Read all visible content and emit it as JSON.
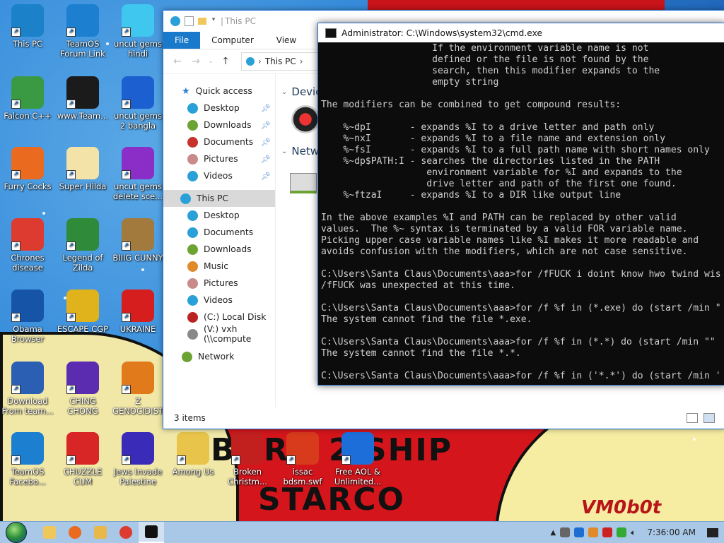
{
  "desktop_icons": [
    {
      "label": "This PC",
      "icon": "this-pc-icon",
      "color": "#1b82c9"
    },
    {
      "label": "TeamOS Forum Link",
      "icon": "gear-icon",
      "color": "#1c7fd0"
    },
    {
      "label": "uncut gems hindi",
      "icon": "diamond-icon",
      "color": "#3fc7ef"
    },
    {
      "label": "Falcon C++",
      "icon": "recycle-icon",
      "color": "#3a9a44"
    },
    {
      "label": "www.Team...",
      "icon": "book-icon",
      "color": "#1b1b1b"
    },
    {
      "label": "uncut gems 2 bangla",
      "icon": "number-two-icon",
      "color": "#1b5fd1"
    },
    {
      "label": "Furry Cocks",
      "icon": "firefox-icon",
      "color": "#ea6a1f"
    },
    {
      "label": "Super Hilda",
      "icon": "pixel-dog-icon",
      "color": "#f4e3a8"
    },
    {
      "label": "uncut gems delete sce...",
      "icon": "gem-icon",
      "color": "#8a2ec7"
    },
    {
      "label": "Chrones disease",
      "icon": "chrome-icon",
      "color": "#dd3b2f"
    },
    {
      "label": "Legend of Zilda",
      "icon": "pixel-hero-icon",
      "color": "#2f8a3a"
    },
    {
      "label": "BIIIG CUNNY",
      "icon": "money-bag-icon",
      "color": "#a27a3d"
    },
    {
      "label": "Obama Browser",
      "icon": "obama-logo-icon",
      "color": "#1654a8"
    },
    {
      "label": "ESCAPE CGP",
      "icon": "box-icon",
      "color": "#e0b21c"
    },
    {
      "label": "UKRAINE",
      "icon": "radiation-icon",
      "color": "#d61e1e"
    },
    {
      "label": "Download From team...",
      "icon": "download-icon",
      "color": "#2b5fb4"
    },
    {
      "label": "CHING CHONG",
      "icon": "orb-icon",
      "color": "#5b2bb0"
    },
    {
      "label": "Z GENOCIDIST",
      "icon": "cube-z-icon",
      "color": "#e07a1a"
    },
    {
      "label": "TeamOS Facebo...",
      "icon": "gear-icon",
      "color": "#1c7fd0"
    },
    {
      "label": "CHUZZLE CUM",
      "icon": "chuzzle-icon",
      "color": "#d82525"
    },
    {
      "label": "Jews Invade Palestine",
      "icon": "orb-icon",
      "color": "#3a2bb8"
    },
    {
      "label": "Among Us",
      "icon": "folder-icon",
      "color": "#e8c54a"
    },
    {
      "label": "Broken Christm...",
      "icon": "ornament-icon",
      "color": "#c2201f"
    },
    {
      "label": "issac bdsm.swf",
      "icon": "swf-file-icon",
      "color": "#d83a1c"
    },
    {
      "label": "Free AOL & Unlimited...",
      "icon": "aol-icon",
      "color": "#1e6ed9"
    }
  ],
  "wallpaper": {
    "text_top": "BORN 2 SHIP",
    "text_bottom": "STARCO",
    "signature": "VM0b0t"
  },
  "explorer": {
    "title": "This PC",
    "tabs": [
      "File",
      "Computer",
      "View"
    ],
    "address": "This PC",
    "nav": {
      "quick_access": "Quick access",
      "quick_items": [
        {
          "label": "Desktop",
          "icon": "desktop-icon",
          "color": "#2aa0d8"
        },
        {
          "label": "Downloads",
          "icon": "downloads-icon",
          "color": "#6da332"
        },
        {
          "label": "Documents",
          "icon": "documents-icon",
          "color": "#c8322c"
        },
        {
          "label": "Pictures",
          "icon": "pictures-icon",
          "color": "#c98a8a"
        },
        {
          "label": "Videos",
          "icon": "videos-icon",
          "color": "#2aa0d8"
        }
      ],
      "this_pc": "This PC",
      "pc_items": [
        {
          "label": "Desktop",
          "icon": "desktop-icon",
          "color": "#2aa0d8"
        },
        {
          "label": "Documents",
          "icon": "documents-icon",
          "color": "#2aa0d8"
        },
        {
          "label": "Downloads",
          "icon": "downloads-icon",
          "color": "#6da332"
        },
        {
          "label": "Music",
          "icon": "music-icon",
          "color": "#e08a2a"
        },
        {
          "label": "Pictures",
          "icon": "pictures-icon",
          "color": "#c98a8a"
        },
        {
          "label": "Videos",
          "icon": "videos-icon",
          "color": "#2aa0d8"
        },
        {
          "label": "(C:) Local Disk",
          "icon": "local-disk-icon",
          "color": "#b22"
        },
        {
          "label": "(V:) vxh (\\\\compute",
          "icon": "network-drive-icon",
          "color": "#888"
        }
      ],
      "network": "Network"
    },
    "content_groups": [
      "Devic",
      "Netwo"
    ],
    "status": "3 items"
  },
  "cmd": {
    "title": "Administrator: C:\\Windows\\system32\\cmd.exe",
    "lines": [
      "                    If the environment variable name is not",
      "                    defined or the file is not found by the",
      "                    search, then this modifier expands to the",
      "                    empty string",
      "",
      "The modifiers can be combined to get compound results:",
      "",
      "    %~dpI       - expands %I to a drive letter and path only",
      "    %~nxI       - expands %I to a file name and extension only",
      "    %~fsI       - expands %I to a full path name with short names only",
      "    %~dp$PATH:I - searches the directories listed in the PATH",
      "                   environment variable for %I and expands to the",
      "                   drive letter and path of the first one found.",
      "    %~ftzaI     - expands %I to a DIR like output line",
      "",
      "In the above examples %I and PATH can be replaced by other valid",
      "values.  The %~ syntax is terminated by a valid FOR variable name.",
      "Picking upper case variable names like %I makes it more readable and",
      "avoids confusion with the modifiers, which are not case sensitive.",
      "",
      "C:\\Users\\Santa Claus\\Documents\\aaa>for /fFUCK i doint know hwo twind wis",
      "/fFUCK was unexpected at this time.",
      "",
      "C:\\Users\\Santa Claus\\Documents\\aaa>for /f %f in (*.exe) do (start /min \"",
      "The system cannot find the file *.exe.",
      "",
      "C:\\Users\\Santa Claus\\Documents\\aaa>for /f %f in (*.*) do (start /min \"\"",
      "The system cannot find the file *.*.",
      "",
      "C:\\Users\\Santa Claus\\Documents\\aaa>for /f %f in ('*.*') do (start /min '"
    ]
  },
  "taskbar": {
    "apps": [
      {
        "name": "file-explorer-pinned-icon",
        "color": "#f0c75a"
      },
      {
        "name": "firefox-icon",
        "color": "#ea6a1f"
      },
      {
        "name": "file-explorer-icon",
        "color": "#e8b84a"
      },
      {
        "name": "chrome-icon",
        "color": "#dd3b2f"
      },
      {
        "name": "cmd-icon",
        "color": "#111111"
      }
    ],
    "clock": "7:36:00 AM"
  }
}
